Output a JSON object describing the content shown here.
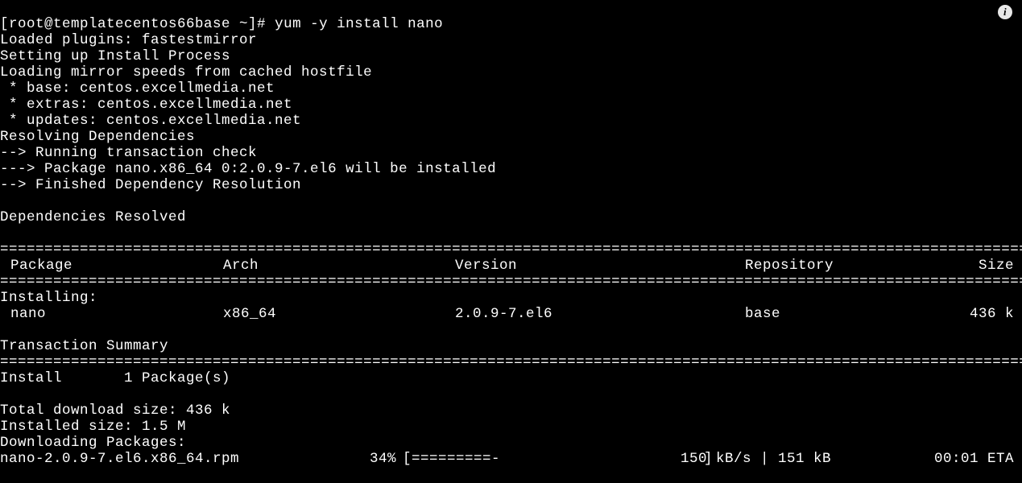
{
  "prompt": "[root@templatecentos66base ~]# ",
  "command": "yum -y install nano",
  "lines_pre": [
    "Loaded plugins: fastestmirror",
    "Setting up Install Process",
    "Loading mirror speeds from cached hostfile",
    " * base: centos.excellmedia.net",
    " * extras: centos.excellmedia.net",
    " * updates: centos.excellmedia.net",
    "Resolving Dependencies",
    "--> Running transaction check",
    "---> Package nano.x86_64 0:2.0.9-7.el6 will be installed",
    "--> Finished Dependency Resolution",
    "",
    "Dependencies Resolved",
    ""
  ],
  "header": {
    "package": "Package",
    "arch": "Arch",
    "version": "Version",
    "repo": "Repository",
    "size": "Size"
  },
  "installing_label": "Installing:",
  "row": {
    "package": "nano",
    "arch": "x86_64",
    "version": "2.0.9-7.el6",
    "repo": "base",
    "size": "436 k"
  },
  "txsummary": "Transaction Summary",
  "install_line": "Install       1 Package(s)",
  "total_dl": "Total download size: 436 k",
  "installed_size": "Installed size: 1.5 M",
  "downloading": "Downloading Packages:",
  "dl": {
    "name": "nano-2.0.9-7.el6.x86_64.rpm",
    "pct": "34%",
    "bar": "[=========-                       ]",
    "speed": "150 kB/s | 151 kB",
    "eta": "00:01 ETA"
  },
  "info_icon": "i"
}
